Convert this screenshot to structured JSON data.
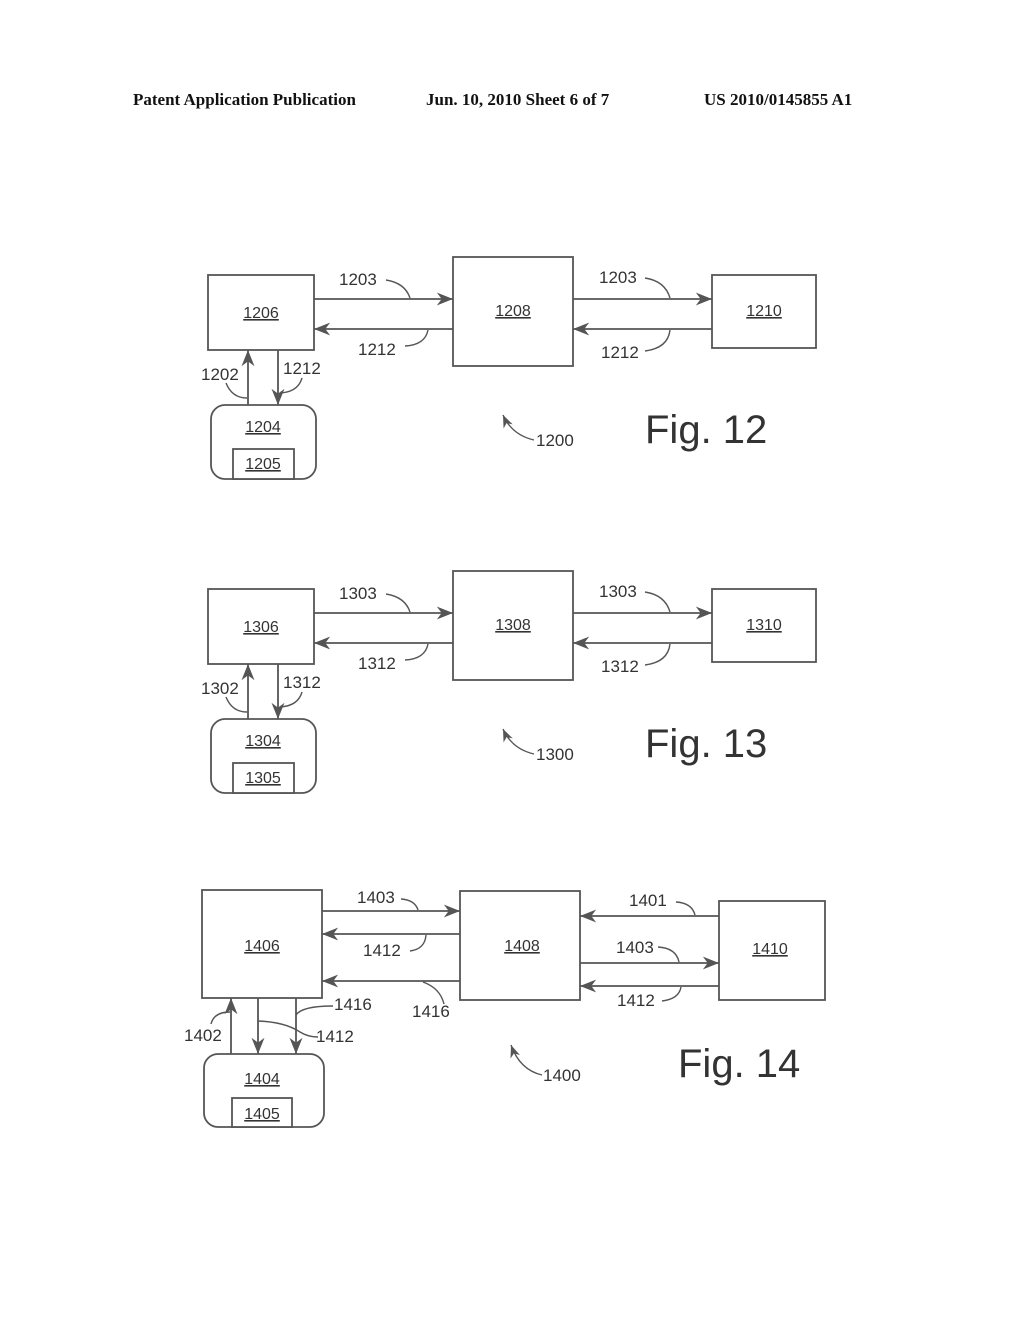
{
  "header": {
    "publication_type": "Patent Application Publication",
    "date_sheet": "Jun. 10, 2010  Sheet 6 of 7",
    "patent_number": "US 2010/0145855 A1"
  },
  "figures": [
    {
      "caption": "Fig. 12",
      "system_ref": "1200",
      "boxes": {
        "left": "1206",
        "middle": "1208",
        "right": "1210",
        "device": "1204",
        "device_inner": "1205"
      },
      "arrows": {
        "left_to_middle": "1203",
        "middle_to_left": "1212",
        "middle_to_right": "1203",
        "right_to_middle": "1212",
        "device_up": "1202",
        "device_down": "1212"
      }
    },
    {
      "caption": "Fig. 13",
      "system_ref": "1300",
      "boxes": {
        "left": "1306",
        "middle": "1308",
        "right": "1310",
        "device": "1304",
        "device_inner": "1305"
      },
      "arrows": {
        "left_to_middle": "1303",
        "middle_to_left": "1312",
        "middle_to_right": "1303",
        "right_to_middle": "1312",
        "device_up": "1302",
        "device_down": "1312"
      }
    },
    {
      "caption": "Fig. 14",
      "system_ref": "1400",
      "boxes": {
        "left": "1406",
        "middle": "1408",
        "right": "1410",
        "device": "1404",
        "device_inner": "1405"
      },
      "arrows": {
        "left_to_middle": "1403",
        "middle_to_left_a": "1412",
        "middle_to_left_b": "1416",
        "right_to_middle_top": "1401",
        "middle_to_right": "1403",
        "right_to_middle_bottom": "1412",
        "device_up": "1402",
        "device_down_a": "1412",
        "device_down_b": "1416"
      }
    }
  ]
}
